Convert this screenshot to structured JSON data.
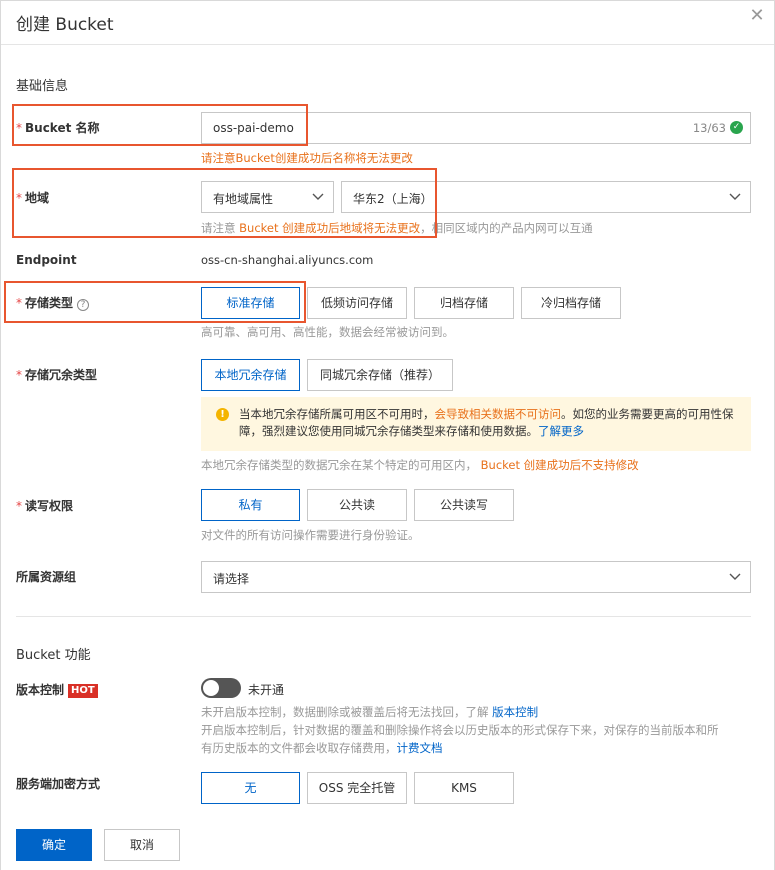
{
  "dialog": {
    "title": "创建 Bucket"
  },
  "basic": {
    "section_title": "基础信息",
    "name": {
      "label": "Bucket 名称",
      "value": "oss-pai-demo",
      "count": "13/63",
      "hint": "请注意Bucket创建成功后名称将无法更改"
    },
    "region": {
      "label": "地域",
      "type_value": "有地域属性",
      "region_value": "华东2（上海）",
      "hint_prefix": "请注意 ",
      "hint_warn": "Bucket 创建成功后地域将无法更改",
      "hint_suffix": "，相同区域内的产品内网可以互通"
    },
    "endpoint": {
      "label": "Endpoint",
      "value": "oss-cn-shanghai.aliyuncs.com"
    },
    "storage_class": {
      "label": "存储类型",
      "options": [
        "标准存储",
        "低频访问存储",
        "归档存储",
        "冷归档存储"
      ],
      "selected": "标准存储",
      "hint": "高可靠、高可用、高性能，数据会经常被访问到。"
    },
    "redundancy": {
      "label": "存储冗余类型",
      "options": [
        "本地冗余存储",
        "同城冗余存储（推荐）"
      ],
      "selected": "本地冗余存储",
      "alert_1": "当本地冗余存储所属可用区不可用时，",
      "alert_warn": "会导致相关数据不可访问",
      "alert_2": "。如您的业务需要更高的可用性保障，强烈建议您使用同城冗余存储类型来存储和使用数据。",
      "alert_link": "了解更多",
      "hint": "本地冗余存储类型的数据冗余在某个特定的可用区内，",
      "hint_warn": "Bucket 创建成功后不支持修改"
    },
    "acl": {
      "label": "读写权限",
      "options": [
        "私有",
        "公共读",
        "公共读写"
      ],
      "selected": "私有",
      "hint": "对文件的所有访问操作需要进行身份验证。"
    },
    "resource_group": {
      "label": "所属资源组",
      "placeholder": "请选择"
    }
  },
  "features": {
    "section_title": "Bucket 功能",
    "versioning": {
      "label": "版本控制",
      "badge": "HOT",
      "state": "未开通",
      "hint1": "未开启版本控制，数据删除或被覆盖后将无法找回，了解 ",
      "hint1_link": "版本控制",
      "hint2": "开启版本控制后，针对数据的覆盖和删除操作将会以历史版本的形式保存下来，对保存的当前版本和所",
      "hint3": "有历史版本的文件都会收取存储费用，",
      "hint3_link": "计费文档"
    },
    "encryption": {
      "label": "服务端加密方式",
      "options": [
        "无",
        "OSS 完全托管",
        "KMS"
      ],
      "selected": "无"
    }
  },
  "footer": {
    "confirm": "确定",
    "cancel": "取消"
  },
  "colors": {
    "primary": "#0064c8",
    "warn": "#e8711b",
    "highlight_box": "#e8562f",
    "required": "#e54545"
  }
}
